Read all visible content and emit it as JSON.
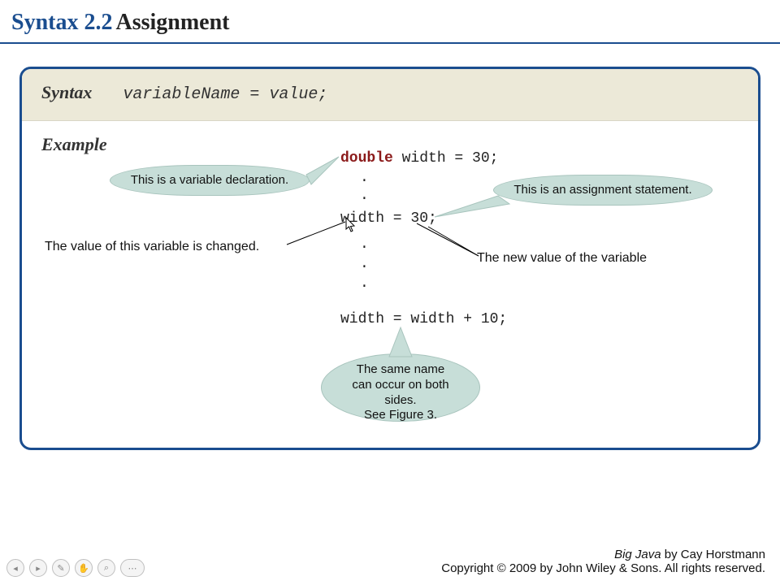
{
  "title": {
    "prefix": "Syntax 2.2",
    "main": "Assignment"
  },
  "syntax": {
    "label": "Syntax",
    "expr": "variableName = value;"
  },
  "example": {
    "label": "Example",
    "code": {
      "line1_kw": "double",
      "line1_rest": " width = 30;",
      "dot": ".",
      "line2": "width = 30;",
      "line3": "width = width + 10;"
    }
  },
  "callouts": {
    "c1": "This is a variable declaration.",
    "c2": "This is an assignment statement.",
    "c3_l1": "The same name",
    "c3_l2": "can occur on both sides.",
    "c3_l3": "See Figure 3."
  },
  "notes": {
    "n1": "The value of this variable is changed.",
    "n2": "The new value of the variable"
  },
  "footer": {
    "book": "Big Java",
    "author": " by Cay Horstmann",
    "copyright": "Copyright © 2009 by John Wiley & Sons.  All rights reserved."
  },
  "nav": {
    "prev": "◂",
    "next": "▸",
    "pen": "✎",
    "hand": "✋",
    "zoom": "⌕",
    "more": "⋯"
  }
}
